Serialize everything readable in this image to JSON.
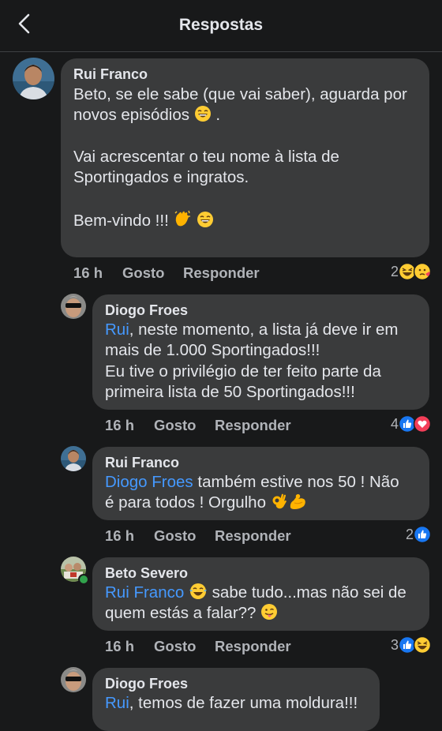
{
  "header": {
    "title": "Respostas"
  },
  "comments": [
    {
      "author": "Rui Franco",
      "lines": [
        "Beto, se ele sabe (que vai saber), aguarda por",
        "novos episódios",
        "Vai acrescentar o teu nome à lista de",
        "Sportingados e ingratos.",
        "Bem-vindo !!!"
      ],
      "time": "16 h",
      "like": "Gosto",
      "reply": "Responder",
      "reaction_count": "2",
      "reaction_icons": [
        "laugh-icon",
        "sad-kiss-icon"
      ]
    },
    {
      "author": "Diogo Froes",
      "mention": "Rui",
      "lines": [
        ", neste momento, a lista já deve ir em",
        "mais de 1.000 Sportingados!!!",
        "Eu tive o privilégio de ter feito parte da",
        "primeira lista de 50 Sportingados!!!"
      ],
      "time": "16 h",
      "like": "Gosto",
      "reply": "Responder",
      "reaction_count": "4",
      "reaction_icons": [
        "like-icon",
        "love-icon"
      ]
    },
    {
      "author": "Rui Franco",
      "mention": "Diogo Froes",
      "lines": [
        " também estive nos 50 ! Não",
        "é para todos ! Orgulho"
      ],
      "time": "16 h",
      "like": "Gosto",
      "reply": "Responder",
      "reaction_count": "2",
      "reaction_icons": [
        "like-icon"
      ]
    },
    {
      "author": "Beto Severo",
      "mention": "Rui Franco",
      "lines": [
        "sabe tudo...mas não sei de",
        "quem estás a falar??"
      ],
      "time": "16 h",
      "like": "Gosto",
      "reply": "Responder",
      "reaction_count": "3",
      "reaction_icons": [
        "like-icon",
        "laugh-icon"
      ]
    },
    {
      "author": "Diogo Froes",
      "mention": "Rui",
      "lines": [
        ", temos de fazer uma moldura!!!"
      ]
    }
  ],
  "colors": {
    "background": "#18191a",
    "bubble": "#3a3b3c",
    "mention": "#4599ff",
    "like_blue": "#1877f2",
    "love_red": "#f33e58"
  }
}
